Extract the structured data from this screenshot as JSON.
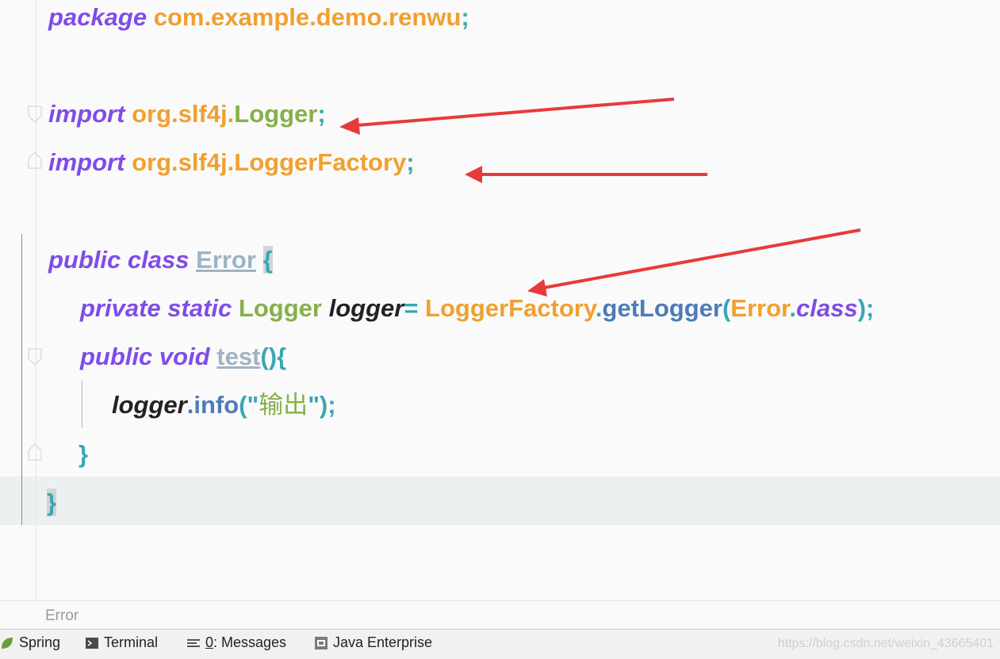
{
  "code": {
    "line1": {
      "kw": "package",
      "pkg": "com.example.demo.renwu",
      "semi": ";"
    },
    "line2": {
      "kw": "import",
      "pkg": "org.slf4j.",
      "cls": "Logger",
      "semi": ";"
    },
    "line3": {
      "kw": "import",
      "pkg": "org.slf4j.LoggerFactory",
      "semi": ";"
    },
    "line4": {
      "kw": "public class",
      "name": "Error",
      "brace": "{"
    },
    "line5": {
      "kw": "private static",
      "type": "Logger",
      "field": "logger",
      "eq": "=",
      "factory": "LoggerFactory",
      "dot1": ".",
      "method": "getLogger",
      "paren1": "(",
      "arg": "Error",
      "dot2": ".",
      "kwclass": "class",
      "end": ");"
    },
    "line6": {
      "kw": "public void",
      "name": "test",
      "rest": "(){"
    },
    "line7": {
      "field": "logger",
      "method": ".info",
      "p1": "(\"",
      "str": "输出",
      "p2": "\");"
    },
    "line8": {
      "brace": "}"
    },
    "line9": {
      "brace": "}"
    }
  },
  "breadcrumb": {
    "label": "Error"
  },
  "toolbar": {
    "spring": "Spring",
    "terminal": "Terminal",
    "messages_num": "0",
    "messages_label": ": Messages",
    "java_enterprise": "Java Enterprise"
  },
  "watermark": "https://blog.csdn.net/weixin_43665401",
  "colors": {
    "keyword": "#7f4ce9",
    "package": "#f0a030",
    "symbol": "#3aa6b4",
    "class": "#85b04a",
    "arrow": "#e83a3a"
  }
}
